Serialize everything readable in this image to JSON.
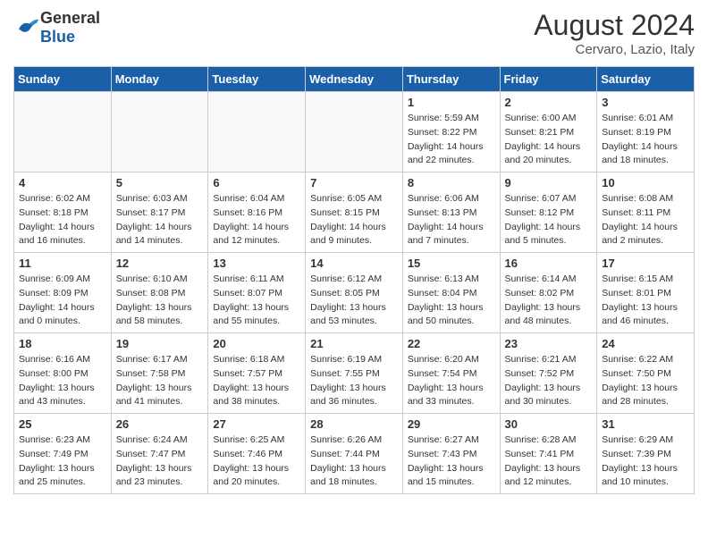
{
  "header": {
    "logo_general": "General",
    "logo_blue": "Blue",
    "month_year": "August 2024",
    "location": "Cervaro, Lazio, Italy"
  },
  "days_of_week": [
    "Sunday",
    "Monday",
    "Tuesday",
    "Wednesday",
    "Thursday",
    "Friday",
    "Saturday"
  ],
  "weeks": [
    [
      {
        "num": "",
        "sunrise": "",
        "sunset": "",
        "daylight": "",
        "empty": true
      },
      {
        "num": "",
        "sunrise": "",
        "sunset": "",
        "daylight": "",
        "empty": true
      },
      {
        "num": "",
        "sunrise": "",
        "sunset": "",
        "daylight": "",
        "empty": true
      },
      {
        "num": "",
        "sunrise": "",
        "sunset": "",
        "daylight": "",
        "empty": true
      },
      {
        "num": "1",
        "sunrise": "Sunrise: 5:59 AM",
        "sunset": "Sunset: 8:22 PM",
        "daylight": "Daylight: 14 hours and 22 minutes.",
        "empty": false
      },
      {
        "num": "2",
        "sunrise": "Sunrise: 6:00 AM",
        "sunset": "Sunset: 8:21 PM",
        "daylight": "Daylight: 14 hours and 20 minutes.",
        "empty": false
      },
      {
        "num": "3",
        "sunrise": "Sunrise: 6:01 AM",
        "sunset": "Sunset: 8:19 PM",
        "daylight": "Daylight: 14 hours and 18 minutes.",
        "empty": false
      }
    ],
    [
      {
        "num": "4",
        "sunrise": "Sunrise: 6:02 AM",
        "sunset": "Sunset: 8:18 PM",
        "daylight": "Daylight: 14 hours and 16 minutes.",
        "empty": false
      },
      {
        "num": "5",
        "sunrise": "Sunrise: 6:03 AM",
        "sunset": "Sunset: 8:17 PM",
        "daylight": "Daylight: 14 hours and 14 minutes.",
        "empty": false
      },
      {
        "num": "6",
        "sunrise": "Sunrise: 6:04 AM",
        "sunset": "Sunset: 8:16 PM",
        "daylight": "Daylight: 14 hours and 12 minutes.",
        "empty": false
      },
      {
        "num": "7",
        "sunrise": "Sunrise: 6:05 AM",
        "sunset": "Sunset: 8:15 PM",
        "daylight": "Daylight: 14 hours and 9 minutes.",
        "empty": false
      },
      {
        "num": "8",
        "sunrise": "Sunrise: 6:06 AM",
        "sunset": "Sunset: 8:13 PM",
        "daylight": "Daylight: 14 hours and 7 minutes.",
        "empty": false
      },
      {
        "num": "9",
        "sunrise": "Sunrise: 6:07 AM",
        "sunset": "Sunset: 8:12 PM",
        "daylight": "Daylight: 14 hours and 5 minutes.",
        "empty": false
      },
      {
        "num": "10",
        "sunrise": "Sunrise: 6:08 AM",
        "sunset": "Sunset: 8:11 PM",
        "daylight": "Daylight: 14 hours and 2 minutes.",
        "empty": false
      }
    ],
    [
      {
        "num": "11",
        "sunrise": "Sunrise: 6:09 AM",
        "sunset": "Sunset: 8:09 PM",
        "daylight": "Daylight: 14 hours and 0 minutes.",
        "empty": false
      },
      {
        "num": "12",
        "sunrise": "Sunrise: 6:10 AM",
        "sunset": "Sunset: 8:08 PM",
        "daylight": "Daylight: 13 hours and 58 minutes.",
        "empty": false
      },
      {
        "num": "13",
        "sunrise": "Sunrise: 6:11 AM",
        "sunset": "Sunset: 8:07 PM",
        "daylight": "Daylight: 13 hours and 55 minutes.",
        "empty": false
      },
      {
        "num": "14",
        "sunrise": "Sunrise: 6:12 AM",
        "sunset": "Sunset: 8:05 PM",
        "daylight": "Daylight: 13 hours and 53 minutes.",
        "empty": false
      },
      {
        "num": "15",
        "sunrise": "Sunrise: 6:13 AM",
        "sunset": "Sunset: 8:04 PM",
        "daylight": "Daylight: 13 hours and 50 minutes.",
        "empty": false
      },
      {
        "num": "16",
        "sunrise": "Sunrise: 6:14 AM",
        "sunset": "Sunset: 8:02 PM",
        "daylight": "Daylight: 13 hours and 48 minutes.",
        "empty": false
      },
      {
        "num": "17",
        "sunrise": "Sunrise: 6:15 AM",
        "sunset": "Sunset: 8:01 PM",
        "daylight": "Daylight: 13 hours and 46 minutes.",
        "empty": false
      }
    ],
    [
      {
        "num": "18",
        "sunrise": "Sunrise: 6:16 AM",
        "sunset": "Sunset: 8:00 PM",
        "daylight": "Daylight: 13 hours and 43 minutes.",
        "empty": false
      },
      {
        "num": "19",
        "sunrise": "Sunrise: 6:17 AM",
        "sunset": "Sunset: 7:58 PM",
        "daylight": "Daylight: 13 hours and 41 minutes.",
        "empty": false
      },
      {
        "num": "20",
        "sunrise": "Sunrise: 6:18 AM",
        "sunset": "Sunset: 7:57 PM",
        "daylight": "Daylight: 13 hours and 38 minutes.",
        "empty": false
      },
      {
        "num": "21",
        "sunrise": "Sunrise: 6:19 AM",
        "sunset": "Sunset: 7:55 PM",
        "daylight": "Daylight: 13 hours and 36 minutes.",
        "empty": false
      },
      {
        "num": "22",
        "sunrise": "Sunrise: 6:20 AM",
        "sunset": "Sunset: 7:54 PM",
        "daylight": "Daylight: 13 hours and 33 minutes.",
        "empty": false
      },
      {
        "num": "23",
        "sunrise": "Sunrise: 6:21 AM",
        "sunset": "Sunset: 7:52 PM",
        "daylight": "Daylight: 13 hours and 30 minutes.",
        "empty": false
      },
      {
        "num": "24",
        "sunrise": "Sunrise: 6:22 AM",
        "sunset": "Sunset: 7:50 PM",
        "daylight": "Daylight: 13 hours and 28 minutes.",
        "empty": false
      }
    ],
    [
      {
        "num": "25",
        "sunrise": "Sunrise: 6:23 AM",
        "sunset": "Sunset: 7:49 PM",
        "daylight": "Daylight: 13 hours and 25 minutes.",
        "empty": false
      },
      {
        "num": "26",
        "sunrise": "Sunrise: 6:24 AM",
        "sunset": "Sunset: 7:47 PM",
        "daylight": "Daylight: 13 hours and 23 minutes.",
        "empty": false
      },
      {
        "num": "27",
        "sunrise": "Sunrise: 6:25 AM",
        "sunset": "Sunset: 7:46 PM",
        "daylight": "Daylight: 13 hours and 20 minutes.",
        "empty": false
      },
      {
        "num": "28",
        "sunrise": "Sunrise: 6:26 AM",
        "sunset": "Sunset: 7:44 PM",
        "daylight": "Daylight: 13 hours and 18 minutes.",
        "empty": false
      },
      {
        "num": "29",
        "sunrise": "Sunrise: 6:27 AM",
        "sunset": "Sunset: 7:43 PM",
        "daylight": "Daylight: 13 hours and 15 minutes.",
        "empty": false
      },
      {
        "num": "30",
        "sunrise": "Sunrise: 6:28 AM",
        "sunset": "Sunset: 7:41 PM",
        "daylight": "Daylight: 13 hours and 12 minutes.",
        "empty": false
      },
      {
        "num": "31",
        "sunrise": "Sunrise: 6:29 AM",
        "sunset": "Sunset: 7:39 PM",
        "daylight": "Daylight: 13 hours and 10 minutes.",
        "empty": false
      }
    ]
  ]
}
